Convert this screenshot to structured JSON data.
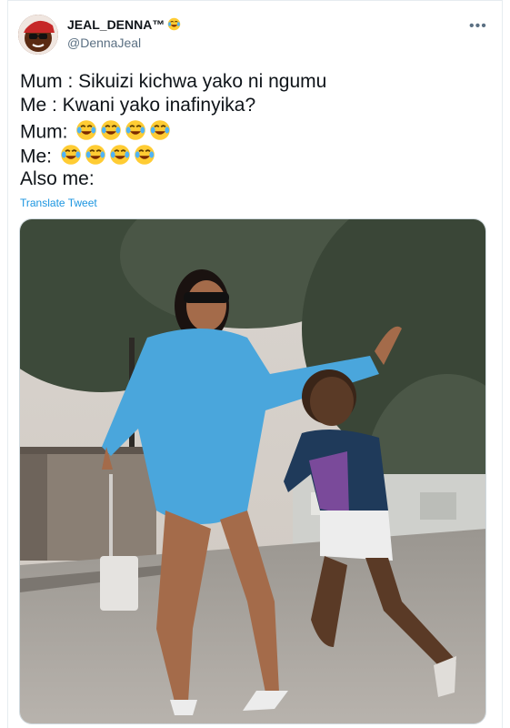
{
  "tweet": {
    "display_name": "JEAL_DENNA™",
    "name_emoji": "face-with-tears-of-joy",
    "handle": "@DennaJeal",
    "lines": [
      "Mum : Sikuizi kichwa yako ni ngumu",
      "Me : Kwani yako inafinyika?",
      "Mum:",
      "Me:",
      "Also me:"
    ],
    "laugh_emoji_count": 4,
    "translate_label": "Translate Tweet",
    "more_icon": "more-icon"
  },
  "colors": {
    "link": "#1b95e0",
    "secondary_text": "#5b7083",
    "dress": "#4aa6dc",
    "shirt": "#1f3a5a"
  }
}
